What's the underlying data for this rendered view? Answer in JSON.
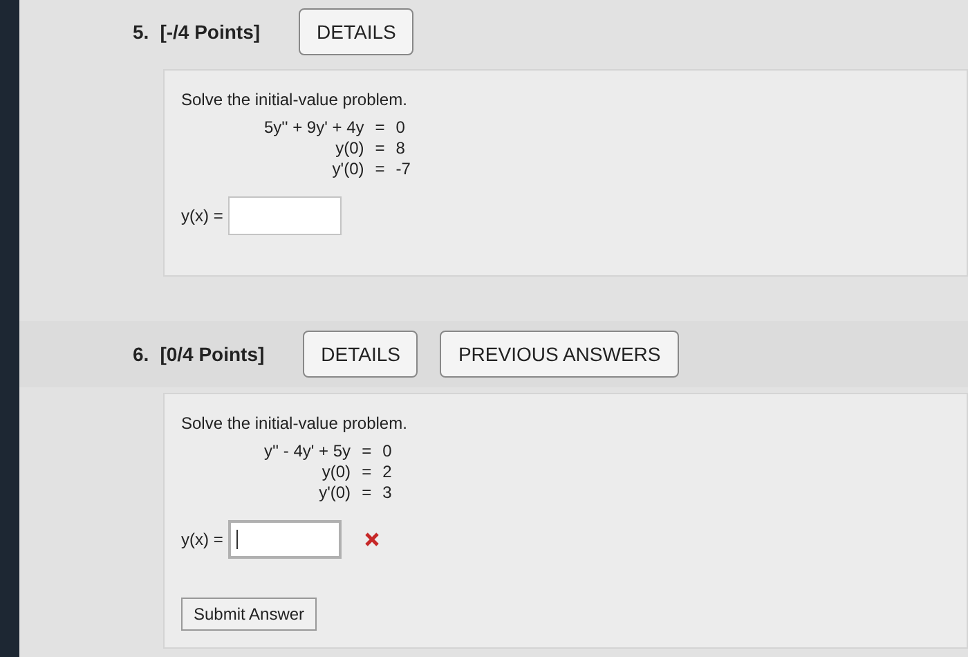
{
  "questions": [
    {
      "number": "5.",
      "points": "[-/4 Points]",
      "buttons": [
        "DETAILS"
      ],
      "prompt": "Solve the initial-value problem.",
      "equations": [
        {
          "lhs": "5y'' + 9y' + 4y",
          "sign": "=",
          "rhs": "0"
        },
        {
          "lhs": "y(0)",
          "sign": "=",
          "rhs": "8"
        },
        {
          "lhs": "y'(0)",
          "sign": "=",
          "rhs": "-7"
        }
      ],
      "answer_label": "y(x) =",
      "answer": {
        "focused": false,
        "wrong": false
      }
    },
    {
      "number": "6.",
      "points": "[0/4 Points]",
      "buttons": [
        "DETAILS",
        "PREVIOUS ANSWERS"
      ],
      "prompt": "Solve the initial-value problem.",
      "equations": [
        {
          "lhs": "y'' - 4y' + 5y",
          "sign": "=",
          "rhs": "0"
        },
        {
          "lhs": "y(0)",
          "sign": "=",
          "rhs": "2"
        },
        {
          "lhs": "y'(0)",
          "sign": "=",
          "rhs": "3"
        }
      ],
      "answer_label": "y(x) =",
      "answer": {
        "focused": true,
        "wrong": true
      },
      "submit_button": "Submit Answer"
    }
  ]
}
